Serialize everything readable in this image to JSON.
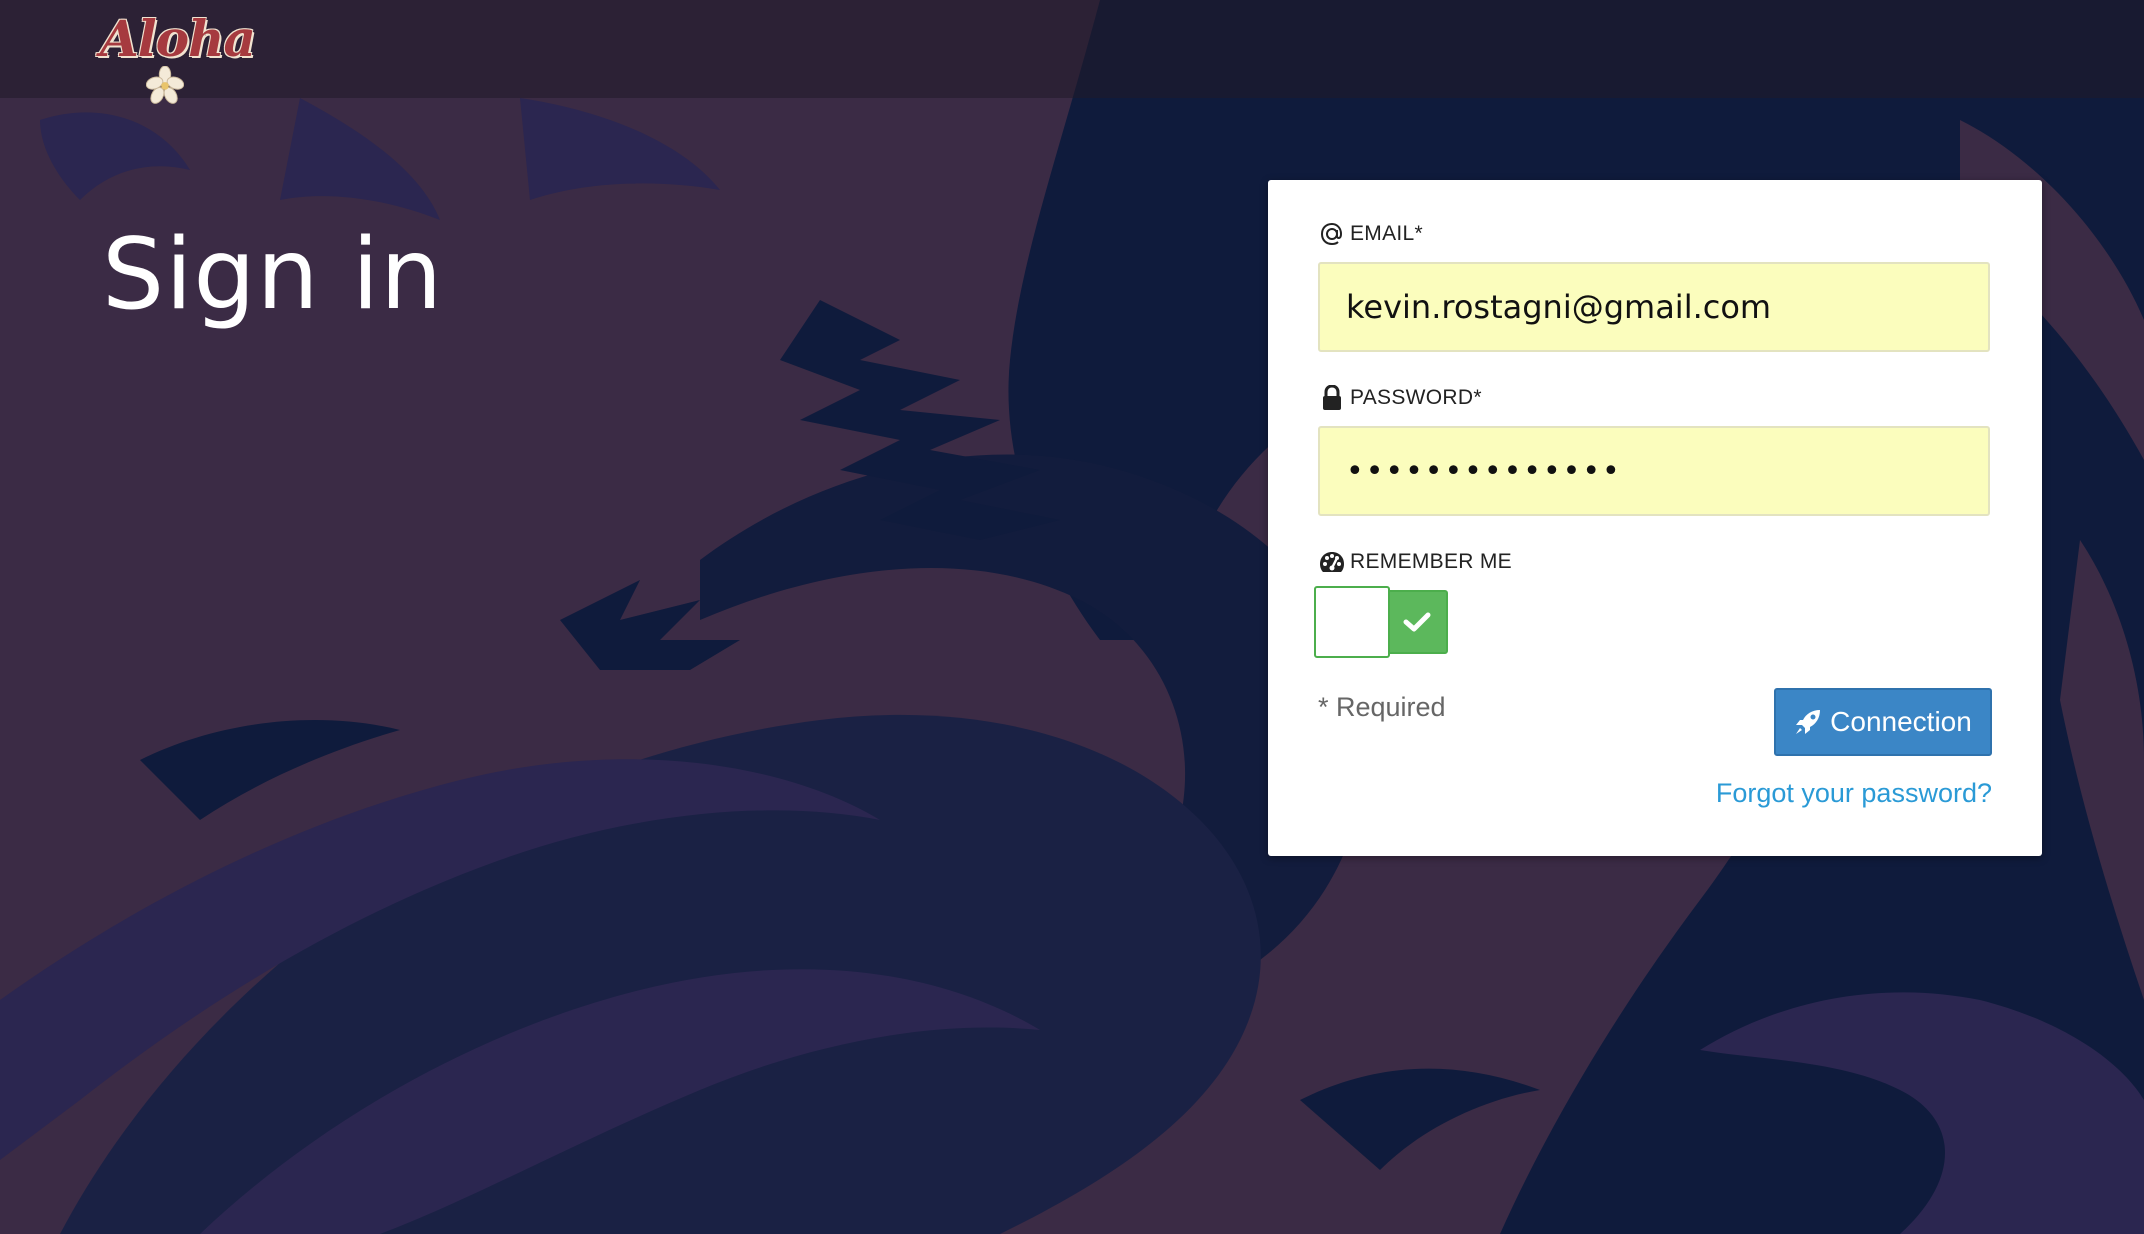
{
  "header": {
    "logo_text": "Aloha"
  },
  "page": {
    "title": "Sign in"
  },
  "form": {
    "email": {
      "label": "EMAIL*",
      "value": "kevin.rostagni@gmail.com",
      "icon": "at-icon"
    },
    "password": {
      "label": "PASSWORD*",
      "value": "••••••••••••••",
      "icon": "lock-icon"
    },
    "remember": {
      "label": "REMEMBER ME",
      "icon": "dashboard-icon",
      "checked": true
    },
    "required_note": "* Required",
    "submit_label": "Connection",
    "submit_icon": "rocket-icon",
    "forgot_label": "Forgot your password?"
  },
  "colors": {
    "background": "#3b2b45",
    "wave_dark": "#0e1a3a",
    "wave_mid": "#2c2750",
    "input_bg": "#fbfdbd",
    "button": "#3b86c6",
    "toggle_on": "#5cb85c",
    "link": "#2a9ad6",
    "logo": "#a63a3f"
  }
}
